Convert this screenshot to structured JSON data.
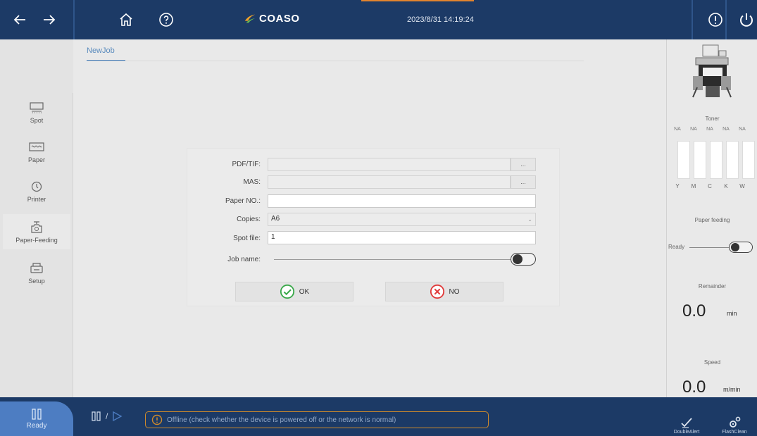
{
  "header": {
    "brand": "COASO",
    "datetime": "2023/8/31 14:19:24",
    "icons": [
      "back-arrow-icon",
      "forward-arrow-icon",
      "home-icon",
      "help-icon",
      "info-icon",
      "power-icon"
    ],
    "accent_color": "#e2842e",
    "bar_color": "#1c3a66"
  },
  "sidebar": {
    "items": [
      {
        "label": "Spot",
        "icon": "spot-icon"
      },
      {
        "label": "Paper",
        "icon": "paper-icon"
      },
      {
        "label": "Printer",
        "icon": "printer-icon"
      },
      {
        "label": "Paper-Feeding",
        "icon": "paper-feeding-icon"
      },
      {
        "label": "Setup",
        "icon": "setup-icon"
      }
    ]
  },
  "main": {
    "tab_label": "NewJob",
    "form": {
      "pdf_label": "PDF/TIF:",
      "pdf_value": "",
      "mas_label": "MAS:",
      "mas_value": "",
      "browse_label": "...",
      "paper_no_label": "Paper NO.:",
      "paper_no_value": "",
      "copies_label": "Copies:",
      "copies_value": "A6",
      "spot_file_label": "Spot file:",
      "spot_file_value": "1",
      "job_name_label": "Job name:"
    },
    "ok_label": "OK",
    "no_label": "NO"
  },
  "right_panel": {
    "toner_title": "Toner",
    "toner": [
      {
        "channel": "Y",
        "value": "NA"
      },
      {
        "channel": "M",
        "value": "NA"
      },
      {
        "channel": "C",
        "value": "NA"
      },
      {
        "channel": "K",
        "value": "NA"
      },
      {
        "channel": "W",
        "value": "NA"
      }
    ],
    "paper_feeding_label": "Paper feeding",
    "paper_feeding_state": "Ready",
    "remainder_label": "Remainder",
    "remainder_value": "0.0",
    "remainder_unit": "min",
    "speed_label": "Speed",
    "speed_value": "0.0",
    "speed_unit": "m/min"
  },
  "footer": {
    "ready_label": "Ready",
    "status_message": "Offline (check whether the device is powered off or the network is normal)",
    "status_color": "#d08a2a",
    "tools": [
      {
        "label": "DoubleAlert",
        "icon": "pen-check-icon"
      },
      {
        "label": "FlashClean",
        "icon": "gears-icon"
      }
    ]
  }
}
